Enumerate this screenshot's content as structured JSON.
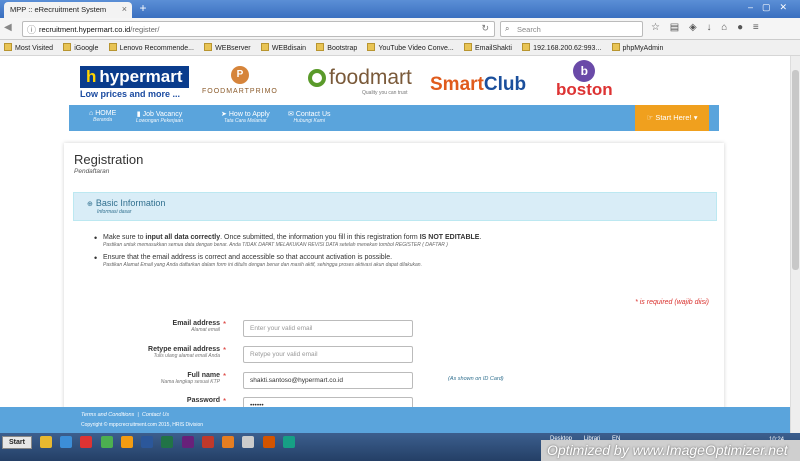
{
  "browser": {
    "tab_title": "MPP :: eRecruitment System",
    "url_host": "recruitment.hypermart.co.id",
    "url_path": "/register/",
    "search_placeholder": "Search",
    "bookmarks": [
      "Most Visited",
      "iGoogle",
      "Lenovo Recommende...",
      "WEBserver",
      "WEBdisain",
      "Bootstrap",
      "YouTube Video Conve...",
      "EmailShakti",
      "192.168.200.62:993...",
      "phpMyAdmin"
    ]
  },
  "brands": {
    "hypermart_name": "hypermart",
    "hypermart_tag": "Low prices and more ...",
    "primo": "FOODMARTPRIMO",
    "foodmart": "foodmart",
    "foodmart_tag": "Quality you can trust",
    "smartclub_1": "Smart",
    "smartclub_2": "Club",
    "boston": "boston"
  },
  "nav": {
    "items": [
      {
        "label": "HOME",
        "sub": "Beranda",
        "icon": "home-icon"
      },
      {
        "label": "Job Vacancy",
        "sub": "Lowongan Pekerjaan",
        "icon": "bookmark-icon"
      },
      {
        "label": "How to Apply",
        "sub": "Tata Cara Melamar",
        "icon": "paper-plane-icon"
      },
      {
        "label": "Contact Us",
        "sub": "Hubungi Kami",
        "icon": "envelope-icon"
      }
    ],
    "start_label": "Start Here!"
  },
  "page": {
    "title": "Registration",
    "subtitle": "Pendaftaran",
    "panel_title": "Basic Information",
    "panel_subtitle": "Informasi dasar",
    "note1_pre": "Make sure to ",
    "note1_bold": "input all data correctly",
    "note1_mid": ". Once submitted, the information you fill in this registration form ",
    "note1_bold2": "IS NOT EDITABLE",
    "note1_end": ".",
    "note1_id": "Pastikan untuk memasukkan semua data dengan benar. Anda TIDAK DAPAT MELAKUKAN REVISI DATA setelah menekan tombol REGISTER ( DAFTAR )",
    "note2": "Ensure that the email address is correct and accessible so that account activation is possible.",
    "note2_id": "Pastikan Alamat Email yang Anda daftarkan dalam form ini ditulis dengan benar dan masih aktif, sehingga proses aktivasi akun dapat dilakukan.",
    "required_note": "* is required (wajib diisi)"
  },
  "form": {
    "email_label": "Email address",
    "email_sub": "Alamat email",
    "email_placeholder": "Enter your valid email",
    "retype_label": "Retype email address",
    "retype_sub": "Tulis ulang alamat email Anda",
    "retype_placeholder": "Retype your valid email",
    "name_label": "Full name",
    "name_sub": "Nama lengkap sesuai KTP",
    "name_value": "shakti.santoso@hypermart.co.id",
    "name_hint": "(As shown on ID Card)",
    "password_label": "Password",
    "password_value": "••••••",
    "star": "*"
  },
  "footer": {
    "terms": "Terms and Conditions",
    "contact": "Contact Us",
    "separator": "|",
    "copyright": "Copyright © mppcrecruitment.com 2015, HRIS Division"
  },
  "taskbar": {
    "start": "Start",
    "tray_items": [
      "Desktop",
      "Librari",
      "EN"
    ],
    "clock": "10:24"
  },
  "watermark": "Optimized by www.ImageOptimizer.net",
  "colors": {
    "nav_blue": "#5aa4dc",
    "start_orange": "#f0a01e",
    "panel_bg": "#d9edf7",
    "panel_text": "#31708f",
    "required_red": "#d9302c"
  }
}
